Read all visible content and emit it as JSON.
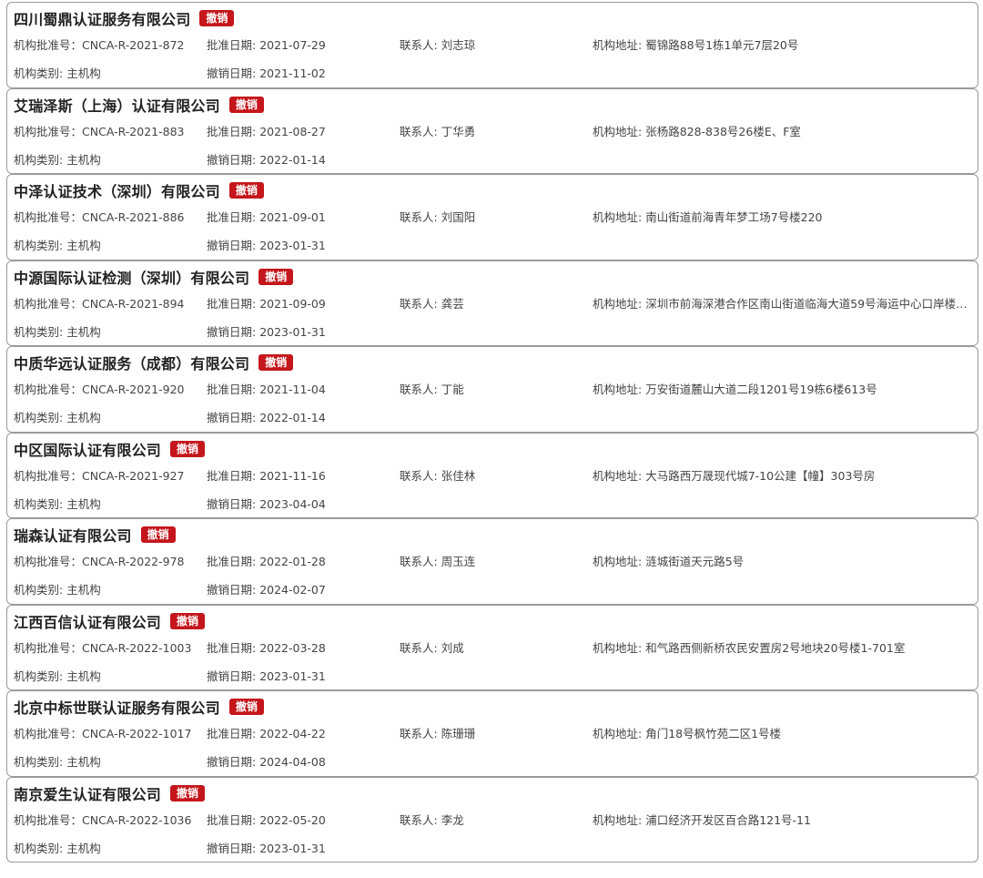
{
  "labels": {
    "approval_no": "机构批准号：",
    "approval_date": "批准日期: ",
    "contact": "联系人: ",
    "address": "机构地址: ",
    "category": "机构类别: ",
    "revoke_date": "撤销日期: "
  },
  "status_badge": "撤销",
  "colors": {
    "badge_bg": "#c4161c",
    "border": "#9a9a9a"
  },
  "orgs": [
    {
      "name": "四川蜀鼎认证服务有限公司",
      "approval_no": "CNCA-R-2021-872",
      "approval_date": "2021-07-29",
      "contact": "刘志琼",
      "address": "蜀锦路88号1栋1单元7层20号",
      "category": "主机构",
      "revoke_date": "2021-11-02"
    },
    {
      "name": "艾瑞泽斯（上海）认证有限公司",
      "approval_no": "CNCA-R-2021-883",
      "approval_date": "2021-08-27",
      "contact": "丁华勇",
      "address": "张杨路828-838号26楼E、F室",
      "category": "主机构",
      "revoke_date": "2022-01-14"
    },
    {
      "name": "中泽认证技术（深圳）有限公司",
      "approval_no": "CNCA-R-2021-886",
      "approval_date": "2021-09-01",
      "contact": "刘国阳",
      "address": "南山街道前海青年梦工场7号楼220",
      "category": "主机构",
      "revoke_date": "2023-01-31"
    },
    {
      "name": "中源国际认证检测（深圳）有限公司",
      "approval_no": "CNCA-R-2021-894",
      "approval_date": "2021-09-09",
      "contact": "龚芸",
      "address": "深圳市前海深港合作区南山街道临海大道59号海运中心口岸楼…",
      "category": "主机构",
      "revoke_date": "2023-01-31"
    },
    {
      "name": "中质华远认证服务（成都）有限公司",
      "approval_no": "CNCA-R-2021-920",
      "approval_date": "2021-11-04",
      "contact": "丁能",
      "address": "万安街道麓山大道二段1201号19栋6楼613号",
      "category": "主机构",
      "revoke_date": "2022-01-14"
    },
    {
      "name": "中区国际认证有限公司",
      "approval_no": "CNCA-R-2021-927",
      "approval_date": "2021-11-16",
      "contact": "张佳林",
      "address": "大马路西万晟现代城7-10公建【幢】303号房",
      "category": "主机构",
      "revoke_date": "2023-04-04"
    },
    {
      "name": "瑞森认证有限公司",
      "approval_no": "CNCA-R-2022-978",
      "approval_date": "2022-01-28",
      "contact": "周玉连",
      "address": "涟城街道天元路5号",
      "category": "主机构",
      "revoke_date": "2024-02-07"
    },
    {
      "name": "江西百信认证有限公司",
      "approval_no": "CNCA-R-2022-1003",
      "approval_date": "2022-03-28",
      "contact": "刘成",
      "address": "和气路西侧新桥农民安置房2号地块20号楼1-701室",
      "category": "主机构",
      "revoke_date": "2023-01-31"
    },
    {
      "name": "北京中标世联认证服务有限公司",
      "approval_no": "CNCA-R-2022-1017",
      "approval_date": "2022-04-22",
      "contact": "陈珊珊",
      "address": "角门18号枫竹苑二区1号楼",
      "category": "主机构",
      "revoke_date": "2024-04-08"
    },
    {
      "name": "南京爱生认证有限公司",
      "approval_no": "CNCA-R-2022-1036",
      "approval_date": "2022-05-20",
      "contact": "李龙",
      "address": "浦口经济开发区百合路121号-11",
      "category": "主机构",
      "revoke_date": "2023-01-31"
    }
  ]
}
